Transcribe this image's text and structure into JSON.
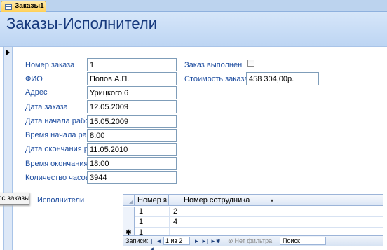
{
  "document_tab": {
    "label": "Заказы1",
    "icon": "form-icon"
  },
  "form": {
    "title": "Заказы-Исполнители",
    "fields": {
      "order_number": {
        "label": "Номер заказа",
        "value": "1"
      },
      "full_name": {
        "label": "ФИО",
        "value": "Попов А.П."
      },
      "address": {
        "label": "Адрес",
        "value": "Урицкого 6"
      },
      "order_date": {
        "label": "Дата заказа",
        "value": "12.05.2009"
      },
      "work_start_date": {
        "label": "Дата начала работ",
        "value": "15.05.2009"
      },
      "work_start_time": {
        "label": "Время начала раб",
        "value": "8:00"
      },
      "end_date": {
        "label": "Дата окончания р",
        "value": "11.05.2010"
      },
      "end_time": {
        "label": "Время окончания",
        "value": "18:00"
      },
      "hours": {
        "label": "Количество часов",
        "value": "3944"
      },
      "completed": {
        "label": "Заказ выполнен",
        "checked": false
      },
      "cost": {
        "label": "Стоимость заказа",
        "value": "458 304,00р."
      }
    },
    "performers_label": "Исполнители",
    "tooltip": "ос заказы"
  },
  "subform": {
    "columns": [
      {
        "label": "Номер з",
        "dropdown": "▾"
      },
      {
        "label": "Номер сотрудника",
        "dropdown": "▾"
      }
    ],
    "rows": [
      {
        "selector": "",
        "cells": [
          "1",
          "2"
        ]
      },
      {
        "selector": "",
        "cells": [
          "1",
          "4"
        ]
      },
      {
        "selector": "✱",
        "cells": [
          "1",
          ""
        ]
      }
    ],
    "navigation": {
      "records_label": "Записи:",
      "first": "|◄",
      "prev": "◄",
      "position": "1 из 2",
      "next": "►",
      "last": "►|",
      "new": "►✱",
      "filter_icon": "⊗",
      "filter_label": "Нет фильтра",
      "search_placeholder": "Поиск"
    }
  }
}
